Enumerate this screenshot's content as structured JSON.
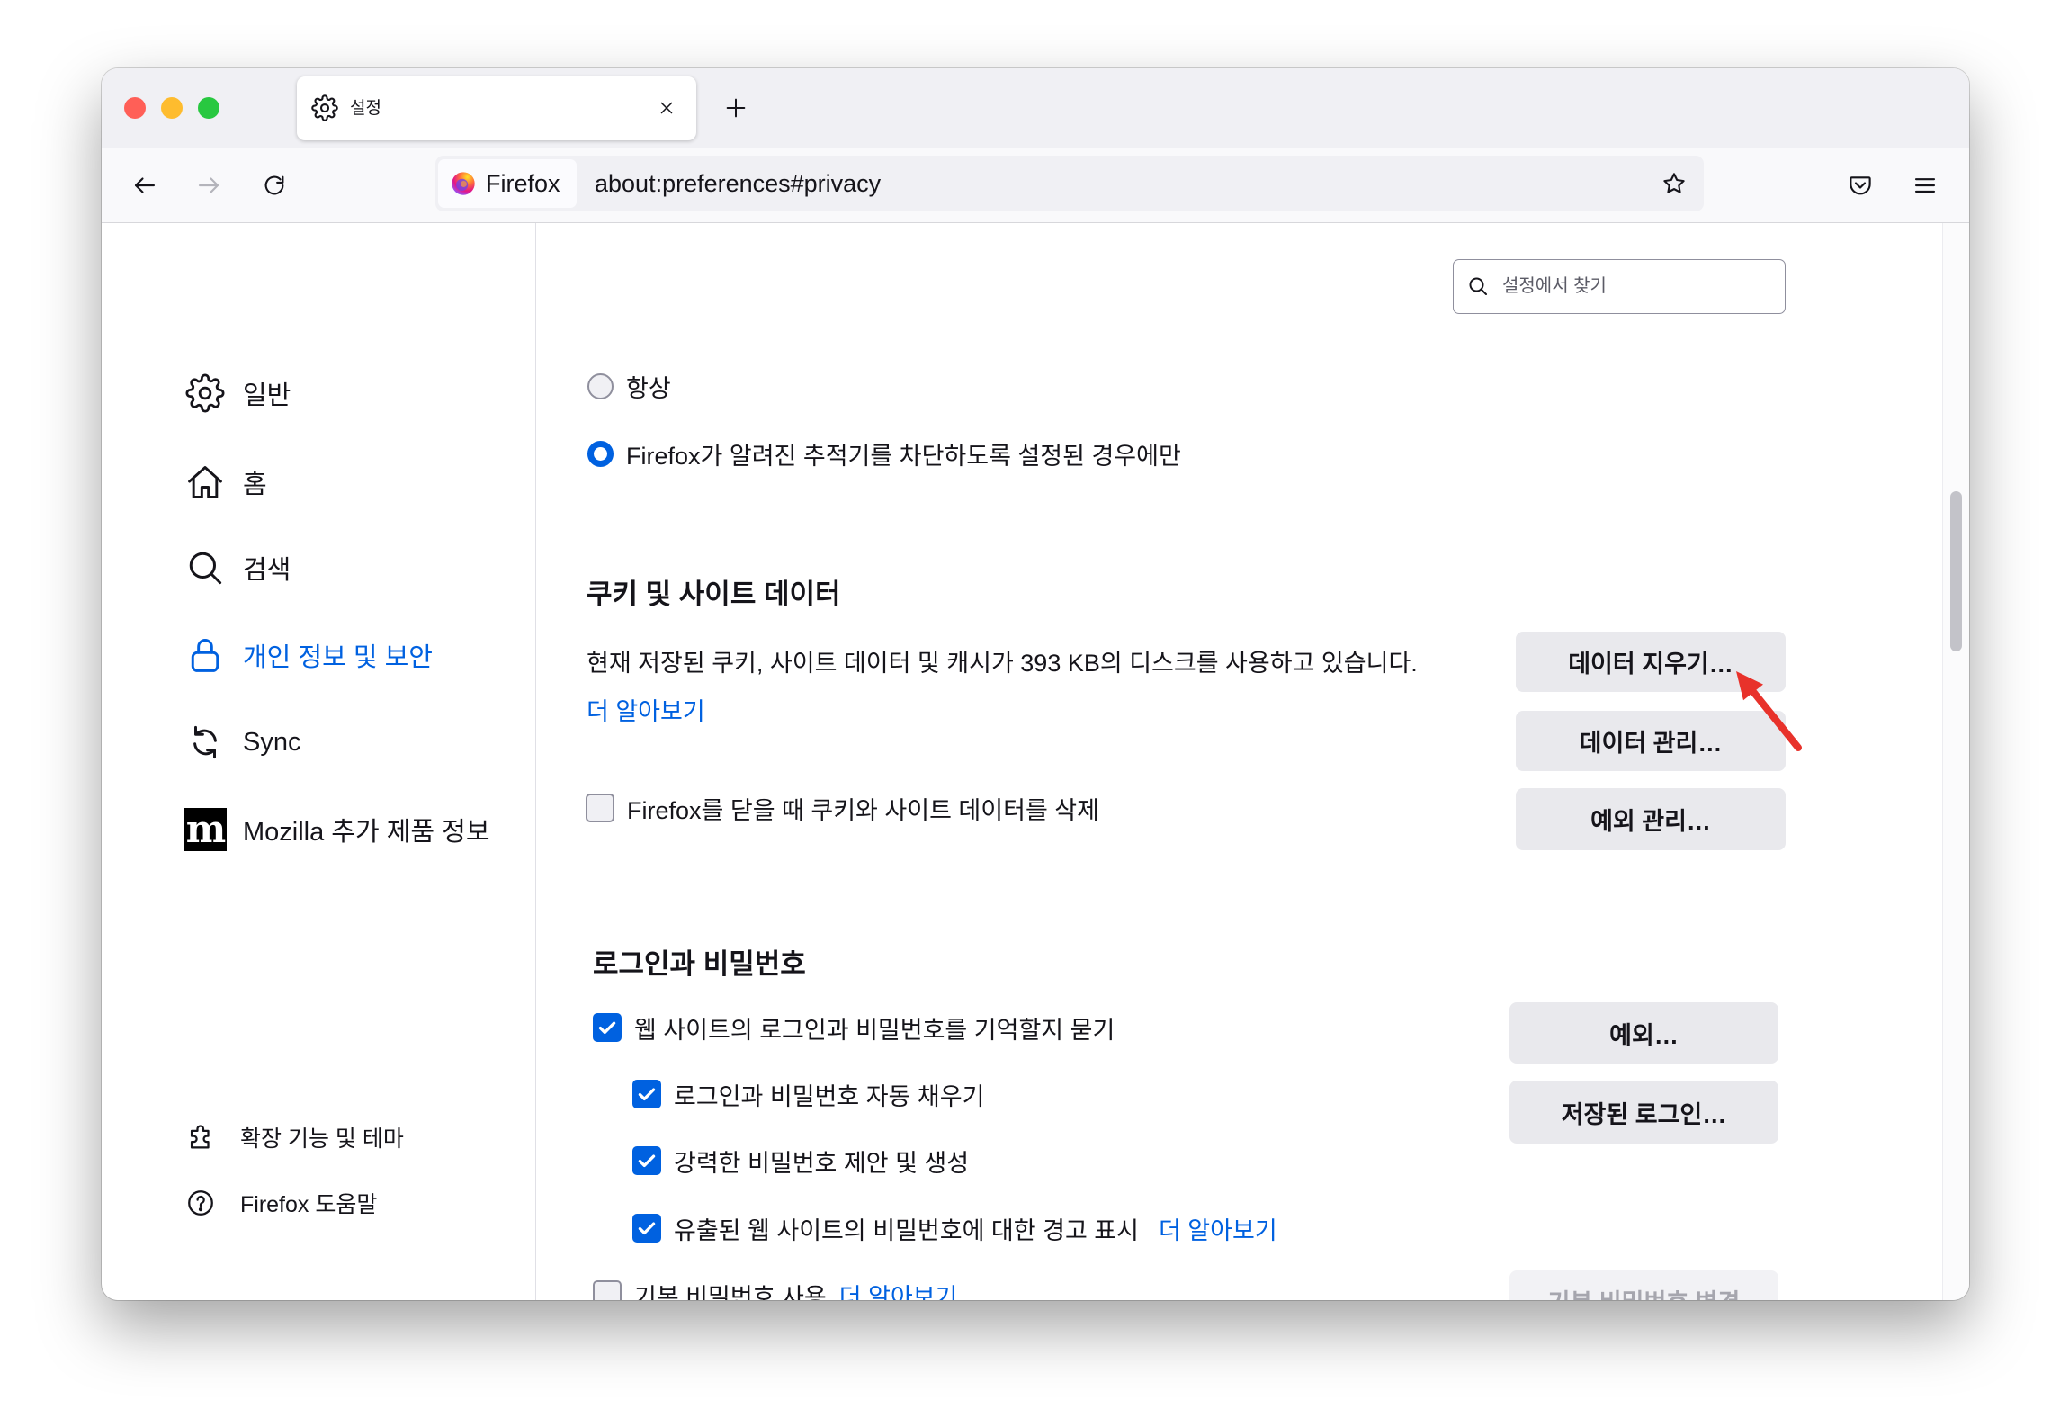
{
  "colors": {
    "accent": "#0061e0",
    "arrow": "#e8322b",
    "close_light": "#ff5f57",
    "minimize_light": "#febc2e",
    "zoom_light": "#28c840"
  },
  "browser": {
    "tab": {
      "title": "설정",
      "icon": "gear-icon"
    },
    "urlbar": {
      "identity_label": "Firefox",
      "url": "about:preferences#privacy"
    },
    "toolbar_icons": [
      "back-arrow-icon",
      "forward-arrow-icon",
      "reload-icon",
      "star-icon",
      "pocket-icon",
      "hamburger-menu-icon"
    ]
  },
  "search": {
    "placeholder": "설정에서 찾기"
  },
  "sidebar": {
    "categories": [
      {
        "label": "일반",
        "icon": "gear-icon",
        "selected": false
      },
      {
        "label": "홈",
        "icon": "home-icon",
        "selected": false
      },
      {
        "label": "검색",
        "icon": "search-icon",
        "selected": false
      },
      {
        "label": "개인 정보 및 보안",
        "icon": "lock-icon",
        "selected": true
      },
      {
        "label": "Sync",
        "icon": "sync-icon",
        "selected": false
      },
      {
        "label": "Mozilla 추가 제품 정보",
        "icon": "mozilla-logo-icon",
        "selected": false
      }
    ],
    "mozilla_logo_letter": "m",
    "footer": [
      {
        "label": "확장 기능 및 테마",
        "icon": "puzzle-icon"
      },
      {
        "label": "Firefox 도움말",
        "icon": "help-icon"
      }
    ]
  },
  "tracking_options": [
    {
      "label": "항상",
      "checked": false
    },
    {
      "label": "Firefox가 알려진 추적기를 차단하도록 설정된 경우에만",
      "checked": true
    }
  ],
  "cookies": {
    "heading": "쿠키 및 사이트 데이터",
    "description": "현재 저장된 쿠키, 사이트 데이터 및 캐시가 393 KB의 디스크를 사용하고 있습니다.",
    "learn_more": "더 알아보기",
    "clear_button": "데이터 지우기…",
    "manage_button": "데이터 관리…",
    "exceptions_button": "예외 관리…",
    "delete_on_close": {
      "label": "Firefox를 닫을 때 쿠키와 사이트 데이터를 삭제",
      "checked": false
    }
  },
  "logins": {
    "heading": "로그인과 비밀번호",
    "options": [
      {
        "label": "웹 사이트의 로그인과 비밀번호를 기억할지 묻기",
        "checked": true
      },
      {
        "label": "로그인과 비밀번호 자동 채우기",
        "checked": true
      },
      {
        "label": "강력한 비밀번호 제안 및 생성",
        "checked": true
      },
      {
        "label": "유출된 웹 사이트의 비밀번호에 대한 경고 표시",
        "checked": true
      }
    ],
    "breach_learn_more": "더 알아보기",
    "exceptions_button": "예외…",
    "saved_logins_button": "저장된 로그인…",
    "primary_password": {
      "label": "기본 비밀번호 사용",
      "checked": false,
      "learn_more": "더 알아보기",
      "change_button": "기본 비밀번호 변경"
    }
  }
}
